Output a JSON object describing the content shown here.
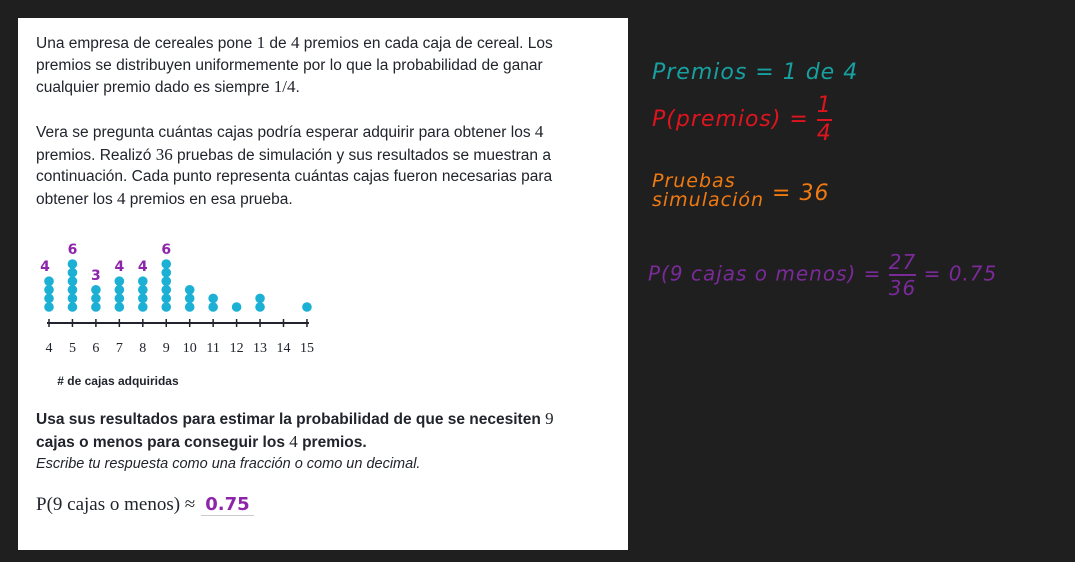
{
  "problem": {
    "p1": [
      "Una empresa de cereales pone ",
      "1",
      " de ",
      "4",
      " premios en cada caja de cereal. Los premios se distribuyen uniformemente por lo que la probabilidad de ganar cualquier premio dado es siempre ",
      "1/4",
      "."
    ],
    "p2": [
      "Vera se pregunta cuántas cajas podría esperar adquirir para obtener los ",
      "4",
      " premios. Realizó ",
      "36",
      " pruebas de simulación y sus resultados se muestran a continuación. Cada punto representa cuántas cajas fueron necesarias para obtener los ",
      "4",
      " premios en esa prueba."
    ],
    "question": [
      "Usa sus resultados para estimar la probabilidad de que se necesiten ",
      "9",
      " cajas o menos para conseguir los ",
      "4",
      " premios."
    ],
    "instruction": "Escribe tu respuesta como una fracción o como un decimal.",
    "answer_label": "P(9 cajas o menos) ≈",
    "answer_value": "0.75"
  },
  "chart_data": {
    "type": "dotplot",
    "x": [
      4,
      5,
      6,
      7,
      8,
      9,
      10,
      11,
      12,
      13,
      14,
      15
    ],
    "counts": [
      4,
      6,
      3,
      4,
      4,
      6,
      3,
      2,
      1,
      2,
      0,
      1
    ],
    "xlabel": "# de cajas adquiridas",
    "annotations": [
      {
        "x": 4,
        "label": "4"
      },
      {
        "x": 5,
        "label": "6"
      },
      {
        "x": 6,
        "label": "3"
      },
      {
        "x": 7,
        "label": "4"
      },
      {
        "x": 8,
        "label": "4"
      },
      {
        "x": 9,
        "label": "6"
      }
    ],
    "dot_color": "#1cb0d4",
    "annotation_color": "#8e24aa"
  },
  "notes": {
    "line1": "Premios = 1 de 4",
    "line2_left": "P(premios) =",
    "line2_num": "1",
    "line2_den": "4",
    "line3_a": "Pruebas",
    "line3_b": "simulación",
    "line3_val": "= 36",
    "line4_left": "P(9 cajas o menos) =",
    "line4_num": "27",
    "line4_den": "36",
    "line4_right": "= 0.75",
    "colors": {
      "teal": "#18a0a0",
      "red": "#e0141e",
      "orange": "#f07a10",
      "purple": "#7b2a9a"
    }
  }
}
